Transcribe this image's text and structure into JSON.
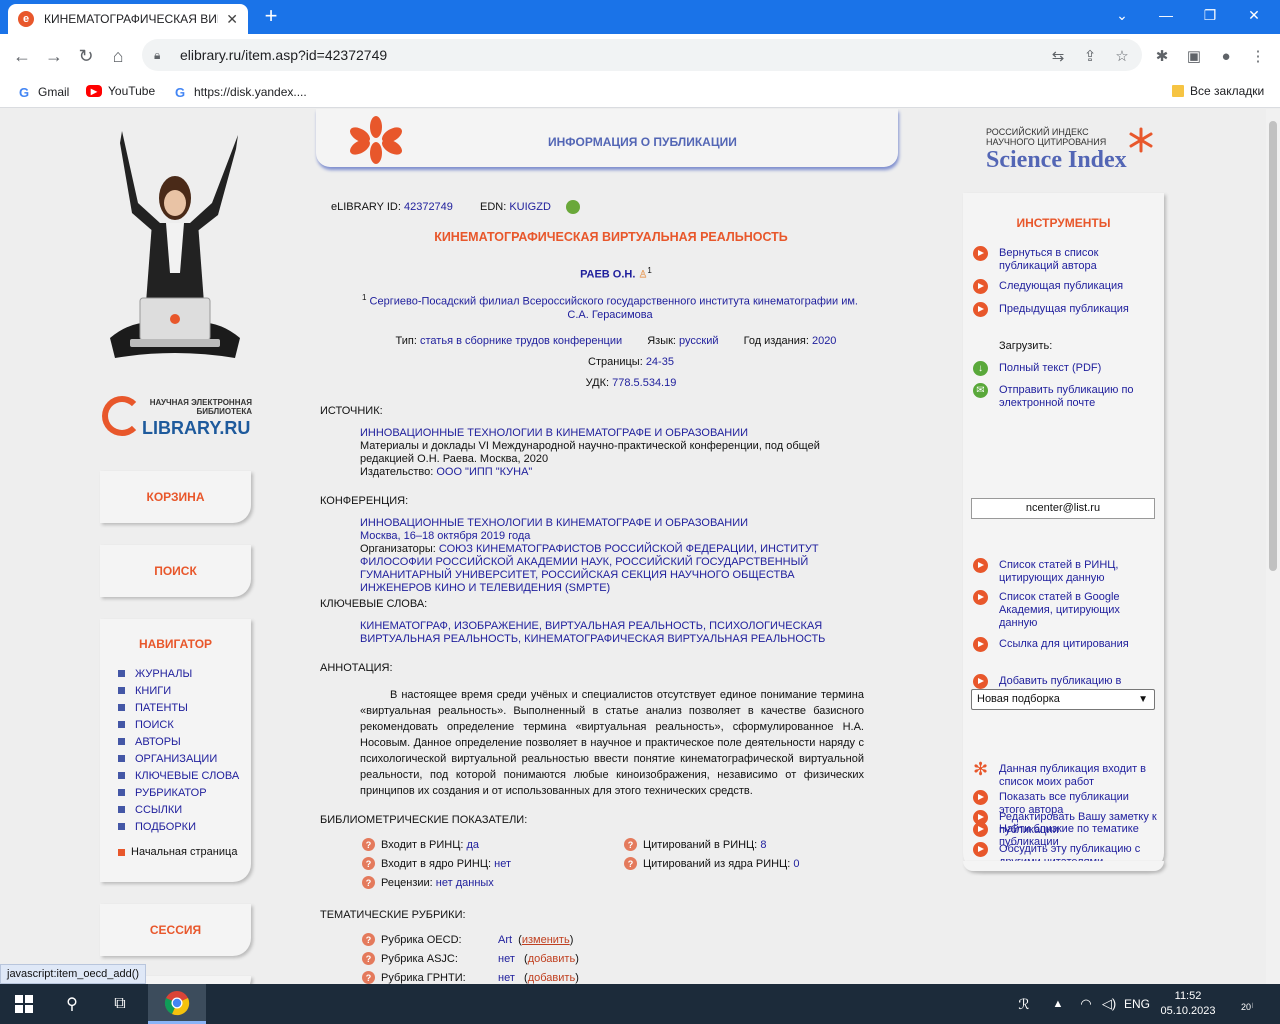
{
  "browser": {
    "tab_title": "КИНЕМАТОГРАФИЧЕСКАЯ ВИРТ",
    "url": "elibrary.ru/item.asp?id=42372749",
    "bookmarks": [
      "Gmail",
      "YouTube",
      "https://disk.yandex...."
    ],
    "all_bookmarks": "Все закладки"
  },
  "left": {
    "logo_small": "НАУЧНАЯ ЭЛЕКТРОННАЯ БИБЛИОТЕКА",
    "logo_big": "LIBRARY.RU",
    "cart": "КОРЗИНА",
    "search": "ПОИСК",
    "navigator": "НАВИГАТОР",
    "nav_items": [
      "ЖУРНАЛЫ",
      "КНИГИ",
      "ПАТЕНТЫ",
      "ПОИСК",
      "АВТОРЫ",
      "ОРГАНИЗАЦИИ",
      "КЛЮЧЕВЫЕ СЛОВА",
      "РУБРИКАТОР",
      "ССЫЛКИ",
      "ПОДБОРКИ"
    ],
    "home": "Начальная страница",
    "session": "СЕССИЯ"
  },
  "center": {
    "banner": "ИНФОРМАЦИЯ О ПУБЛИКАЦИИ",
    "id_label": "eLIBRARY ID:",
    "id_value": "42372749",
    "edn_label": "EDN:",
    "edn_value": "KUIGZD",
    "title": "КИНЕМАТОГРАФИЧЕСКАЯ ВИРТУАЛЬНАЯ РЕАЛЬНОСТЬ",
    "author": "РАЕВ О.Н.",
    "author_sup": "1",
    "affil_sup": "1",
    "affiliation": "Сергиево-Посадский филиал Всероссийского государственного института кинематографии им. С.А. Герасимова",
    "type_label": "Тип:",
    "type_value": "статья в сборнике трудов конференции",
    "lang_label": "Язык:",
    "lang_value": "русский",
    "year_label": "Год издания:",
    "year_value": "2020",
    "pages_label": "Страницы:",
    "pages_value": "24-35",
    "udk_label": "УДК:",
    "udk_value": "778.5.534.19",
    "source_h": "ИСТОЧНИК:",
    "source_title": "ИННОВАЦИОННЫЕ ТЕХНОЛОГИИ В КИНЕМАТОГРАФЕ И ОБРАЗОВАНИИ",
    "source_desc": "Материалы и доклады VI Международной научно-практической конференции, под общей редакцией О.Н. Раева. Москва, 2020",
    "publisher_label": "Издательство:",
    "publisher_value": "ООО \"ИПП \"КУНА\"",
    "conf_h": "КОНФЕРЕНЦИЯ:",
    "conf_title": "ИННОВАЦИОННЫЕ ТЕХНОЛОГИИ В КИНЕМАТОГРАФЕ И ОБРАЗОВАНИИ",
    "conf_place": "Москва, 16–18 октября 2019 года",
    "org_label": "Организаторы:",
    "org_value": "СОЮЗ КИНЕМАТОГРАФИСТОВ РОССИЙСКОЙ ФЕДЕРАЦИИ, ИНСТИТУТ ФИЛОСОФИИ РОССИЙСКОЙ АКАДЕМИИ НАУК, РОССИЙСКИЙ ГОСУДАРСТВЕННЫЙ ГУМАНИТАРНЫЙ УНИВЕРСИТЕТ, РОССИЙСКАЯ СЕКЦИЯ НАУЧНОГО ОБЩЕСТВА ИНЖЕНЕРОВ КИНО И ТЕЛЕВИДЕНИЯ (SMPTE)",
    "kw_h": "КЛЮЧЕВЫЕ СЛОВА:",
    "keywords": "КИНЕМАТОГРАФ, ИЗОБРАЖЕНИЕ, ВИРТУАЛЬНАЯ РЕАЛЬНОСТЬ, ПСИХОЛОГИЧЕСКАЯ ВИРТУАЛЬНАЯ РЕАЛЬНОСТЬ, КИНЕМАТОГРАФИЧЕСКАЯ ВИРТУАЛЬНАЯ РЕАЛЬНОСТЬ",
    "abs_h": "АННОТАЦИЯ:",
    "abstract": "В настоящее время среди учёных и специалистов отсутствует единое понимание термина «виртуальная реальность». Выполненный в статье анализ позволяет в качестве базисного рекомендовать определение термина «виртуальная реальность», сформулированное Н.А. Носовым. Данное определение позволяет в научное и практическое поле деятельности наряду с психологической виртуальной реальностью ввести понятие кинематографической виртуальной реальности, под которой понимаются любые киноизображения, независимо от физических принципов их создания и от использованных для этого технических средств.",
    "biblio_h": "БИБЛИОМЕТРИЧЕСКИЕ ПОКАЗАТЕЛИ:",
    "rinc_in_label": "Входит в РИНЦ:",
    "rinc_in_value": "да",
    "core_in_label": "Входит в ядро РИНЦ:",
    "core_in_value": "нет",
    "reviews_label": "Рецензии:",
    "reviews_value": "нет данных",
    "cit_label": "Цитирований в РИНЦ:",
    "cit_value": "8",
    "cit_core_label": "Цитирований из ядра РИНЦ:",
    "cit_core_value": "0",
    "rub_h": "ТЕМАТИЧЕСКИЕ РУБРИКИ:",
    "oecd_label": "Рубрика OECD:",
    "oecd_value": "Art",
    "oecd_action": "изменить",
    "asjc_label": "Рубрика ASJC:",
    "asjc_value": "нет",
    "asjc_action": "добавить",
    "grnti_label": "Рубрика ГРНТИ:",
    "grnti_value": "нет",
    "grnti_action": "добавить"
  },
  "right": {
    "logo_small": "РОССИЙСКИЙ ИНДЕКС НАУЧНОГО ЦИТИРОВАНИЯ",
    "logo_big": "Science Index",
    "tools_h": "ИНСТРУМЕНТЫ",
    "back_to_list": "Вернуться в список публикаций автора",
    "next_pub": "Следующая публикация",
    "prev_pub": "Предыдущая публикация",
    "download_label": "Загрузить:",
    "full_text": "Полный текст (PDF)",
    "send_email": "Отправить публикацию по электронной почте",
    "email": "ncenter@list.ru",
    "citing_rinc": "Список статей в РИНЦ, цитирующих данную",
    "citing_google": "Список статей в Google Академия, цитирующих данную",
    "cite_link": "Ссылка для цитирования",
    "add_to_collection": "Добавить публикацию в подборку",
    "collection_select": "Новая подборка",
    "in_my_works": "Данная публикация входит в список моих работ",
    "edit_note": "Редактировать Вашу заметку к публикации",
    "discuss": "Обсудить эту публикацию с другими читателями",
    "show_all_author": "Показать все публикации этого автора",
    "find_similar": "Найти близкие по тематике публикации"
  },
  "status_bar": "javascript:item_oecd_add()",
  "taskbar": {
    "lang": "ENG",
    "time": "11:52",
    "date": "05.10.2023",
    "notif_count": "20"
  }
}
